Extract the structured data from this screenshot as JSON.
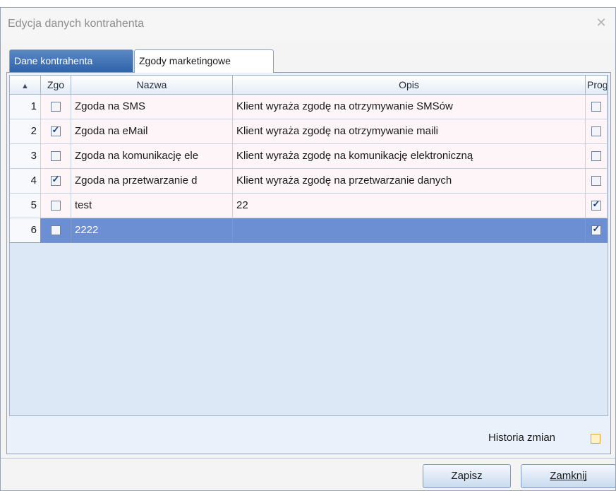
{
  "window": {
    "title": "Edycja danych kontrahenta",
    "close_glyph": "✕"
  },
  "tabs": [
    {
      "label": "Dane kontrahenta",
      "active": false
    },
    {
      "label": "Zgody marketingowe",
      "active": true
    }
  ],
  "grid": {
    "columns": {
      "sort_glyph": "▲",
      "zgoda": "Zgo",
      "nazwa": "Nazwa",
      "opis": "Opis",
      "prog": "Prog"
    },
    "rows": [
      {
        "index": "1",
        "zgoda": false,
        "nazwa": "Zgoda na SMS",
        "opis": "Klient wyraża zgodę na otrzymywanie SMSów",
        "prog": false,
        "selected": false
      },
      {
        "index": "2",
        "zgoda": true,
        "nazwa": "Zgoda na eMail",
        "opis": "Klient wyraża zgodę na otrzymywanie maili",
        "prog": false,
        "selected": false
      },
      {
        "index": "3",
        "zgoda": false,
        "nazwa": "Zgoda na komunikację ele",
        "opis": "Klient wyraża zgodę na komunikację elektroniczną",
        "prog": false,
        "selected": false
      },
      {
        "index": "4",
        "zgoda": true,
        "nazwa": "Zgoda na przetwarzanie d",
        "opis": "Klient wyraża zgodę na przetwarzanie danych",
        "prog": false,
        "selected": false
      },
      {
        "index": "5",
        "zgoda": false,
        "nazwa": "test",
        "opis": "22",
        "prog": true,
        "selected": false
      },
      {
        "index": "6",
        "zgoda": false,
        "nazwa": "2222",
        "opis": "",
        "prog": true,
        "selected": true
      }
    ]
  },
  "history": {
    "label": "Historia zmian",
    "checked": false
  },
  "buttons": {
    "save": "Zapisz",
    "close": "Zamknij"
  },
  "colors": {
    "row_bg": "#fdf5f8",
    "selected_bg": "#6b8fd2",
    "selected_text": "#ffffff",
    "tab_active_bg": "#ffffff",
    "tab_inactive_bg": "#3d6fb3"
  }
}
